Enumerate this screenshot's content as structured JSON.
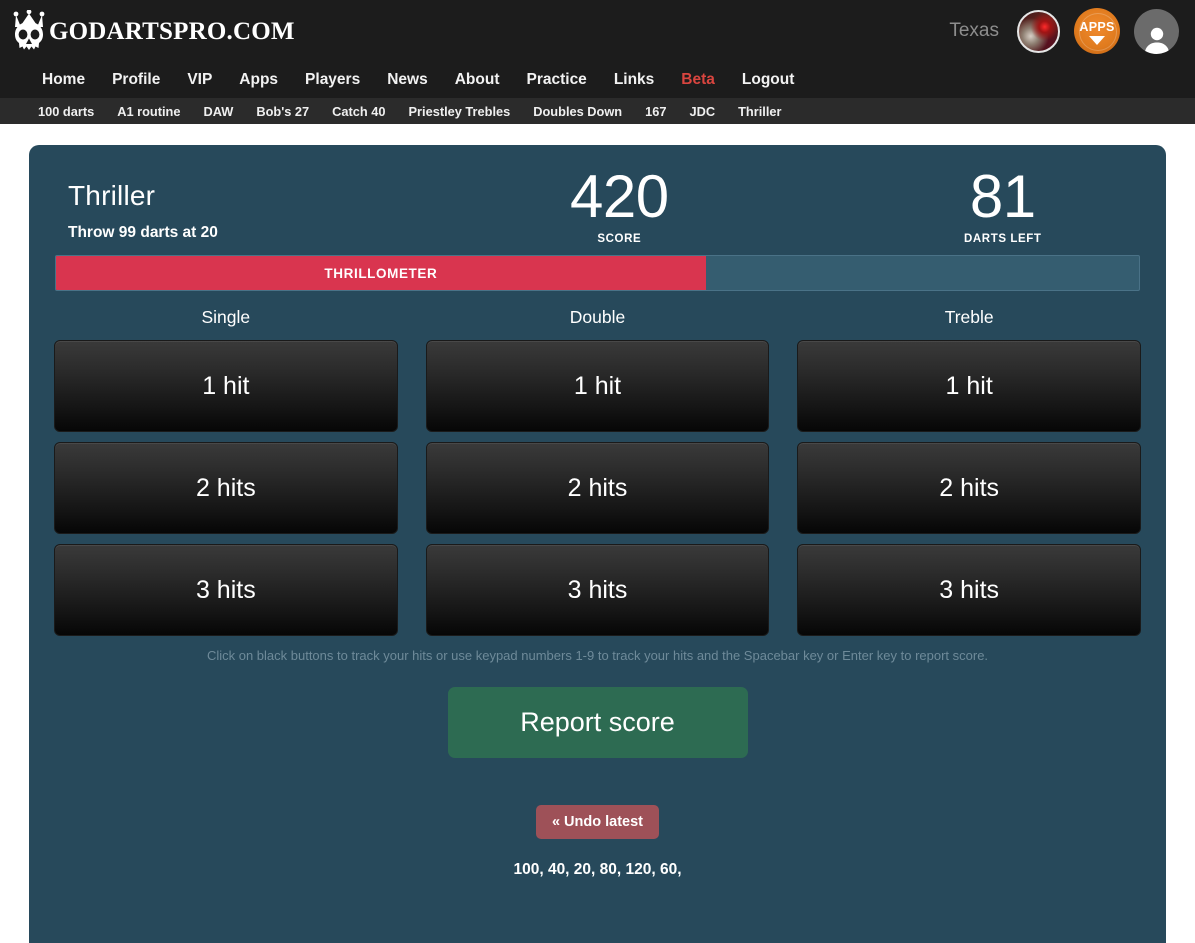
{
  "brand": {
    "name": "GODARTSPRO.COM",
    "logo_icon": "crowned-skull-icon"
  },
  "topbar": {
    "player_name": "Texas",
    "avatar_photo_icon": "player-photo-avatar",
    "apps_badge_label": "APPS",
    "apps_badge_icon": "apps-globe-icon",
    "user_avatar_icon": "user-silhouette-icon"
  },
  "mainnav": [
    {
      "label": "Home",
      "active": false
    },
    {
      "label": "Profile",
      "active": false
    },
    {
      "label": "VIP",
      "active": false
    },
    {
      "label": "Apps",
      "active": false
    },
    {
      "label": "Players",
      "active": false
    },
    {
      "label": "News",
      "active": false
    },
    {
      "label": "About",
      "active": false
    },
    {
      "label": "Practice",
      "active": false
    },
    {
      "label": "Links",
      "active": false
    },
    {
      "label": "Beta",
      "active": true
    },
    {
      "label": "Logout",
      "active": false
    }
  ],
  "subnav": [
    {
      "label": "100 darts"
    },
    {
      "label": "A1 routine"
    },
    {
      "label": "DAW"
    },
    {
      "label": "Bob's 27"
    },
    {
      "label": "Catch 40"
    },
    {
      "label": "Priestley Trebles"
    },
    {
      "label": "Doubles Down"
    },
    {
      "label": "167"
    },
    {
      "label": "JDC"
    },
    {
      "label": "Thriller"
    }
  ],
  "game": {
    "title": "Thriller",
    "subtitle": "Throw 99 darts at 20",
    "score_value": "420",
    "score_label": "SCORE",
    "darts_value": "81",
    "darts_label": "DARTS LEFT"
  },
  "meter": {
    "label": "THRILLOMETER",
    "fill_percent": 60,
    "fill_color": "#d9354f",
    "track_color": "#355d70"
  },
  "columns": [
    {
      "heading": "Single",
      "buttons": [
        {
          "label": "1 hit"
        },
        {
          "label": "2 hits"
        },
        {
          "label": "3 hits"
        }
      ]
    },
    {
      "heading": "Double",
      "buttons": [
        {
          "label": "1 hit"
        },
        {
          "label": "2 hits"
        },
        {
          "label": "3 hits"
        }
      ]
    },
    {
      "heading": "Treble",
      "buttons": [
        {
          "label": "1 hit"
        },
        {
          "label": "2 hits"
        },
        {
          "label": "3 hits"
        }
      ]
    }
  ],
  "hint": "Click on black buttons to track your hits or use keypad numbers 1-9 to track your hits and the Spacebar key or Enter key to report score.",
  "report_button": {
    "label": "Report score",
    "color": "#2d6b52"
  },
  "undo_button": {
    "label": "« Undo latest",
    "color": "#9e5158"
  },
  "history": "100, 40, 20, 80, 120, 60,",
  "theme": {
    "panel_bg": "#27495b",
    "topbar_bg": "#1c1c1c",
    "subnav_bg": "#2b2b2b",
    "accent_red": "#d9453f",
    "accent_orange": "#e07b1e"
  }
}
